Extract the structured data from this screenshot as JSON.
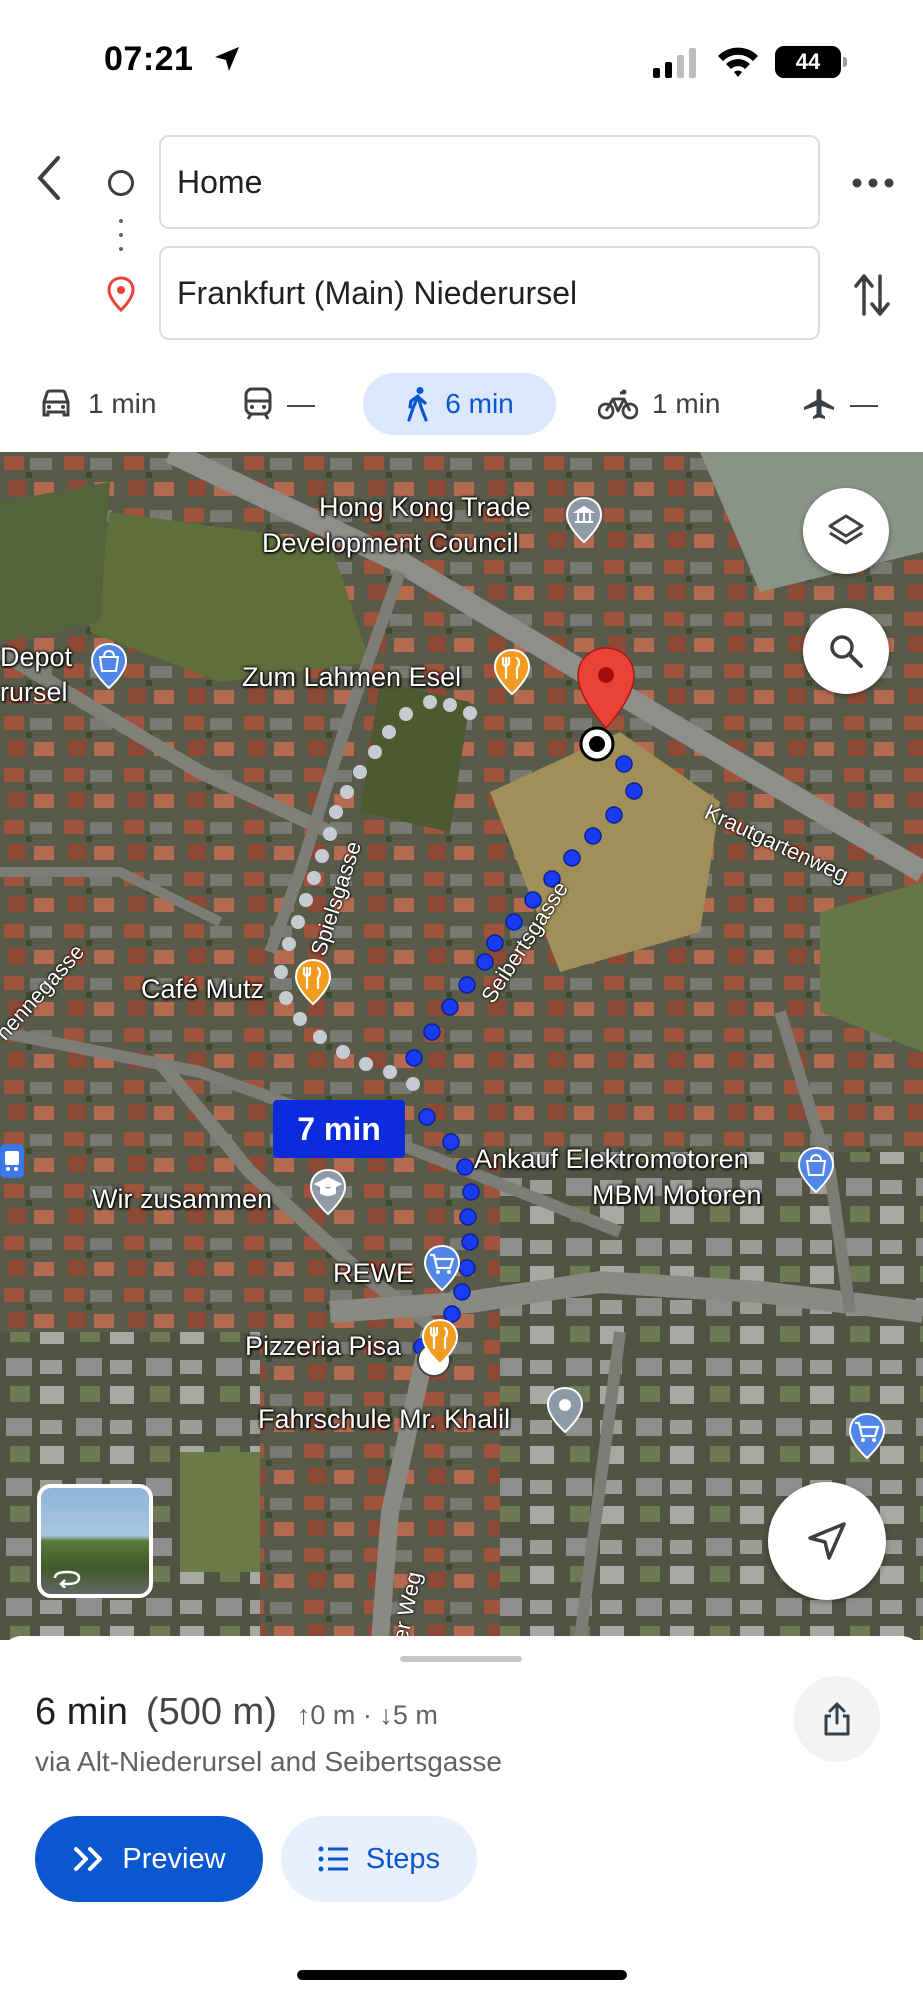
{
  "status_bar": {
    "time": "07:21",
    "battery": "44"
  },
  "directions": {
    "origin_value": "Home",
    "destination_value": "Frankfurt (Main) Niederursel"
  },
  "modes": [
    {
      "name": "car",
      "label": "1 min",
      "icon": "car-icon"
    },
    {
      "name": "transit",
      "label": "—",
      "icon": "train-icon"
    },
    {
      "name": "walk",
      "label": "6 min",
      "icon": "walk-icon",
      "selected": true
    },
    {
      "name": "bike",
      "label": "1 min",
      "icon": "bike-icon"
    },
    {
      "name": "flight",
      "label": "—",
      "icon": "plane-icon"
    }
  ],
  "map": {
    "labels": {
      "hk_trade_1": "Hong Kong Trade",
      "hk_trade_2": "Development Council",
      "zum_lahmen": "Zum Lahmen Esel",
      "depot_1": "Depot",
      "depot_2": "rursel",
      "cafe_mutz": "Café Mutz",
      "wir_zusammen": "Wir zusammen",
      "ankauf_1": "Ankauf Elektromotoren",
      "ankauf_2": "MBM Motoren",
      "rewe": "REWE",
      "pizzeria": "Pizzeria Pisa",
      "fahrschule": "Fahrschule Mr. Khalil"
    },
    "streets": {
      "spielsgasse": "Spielsgasse",
      "seibertsgasse": "Seibertsgasse",
      "krautgartenweg": "Krautgartenweg",
      "hennegasse": "hennegasse",
      "weg": "er Weg"
    },
    "route_time_badge": "7 min",
    "route_color": "#1a3cf0",
    "pin_color": "#ea4335"
  },
  "sheet": {
    "duration": "6 min",
    "distance": "(500 m)",
    "elevation": "↑0 m · ↓5 m",
    "via": "via Alt-Niederursel and Seibertsgasse",
    "preview_label": "Preview",
    "steps_label": "Steps"
  }
}
